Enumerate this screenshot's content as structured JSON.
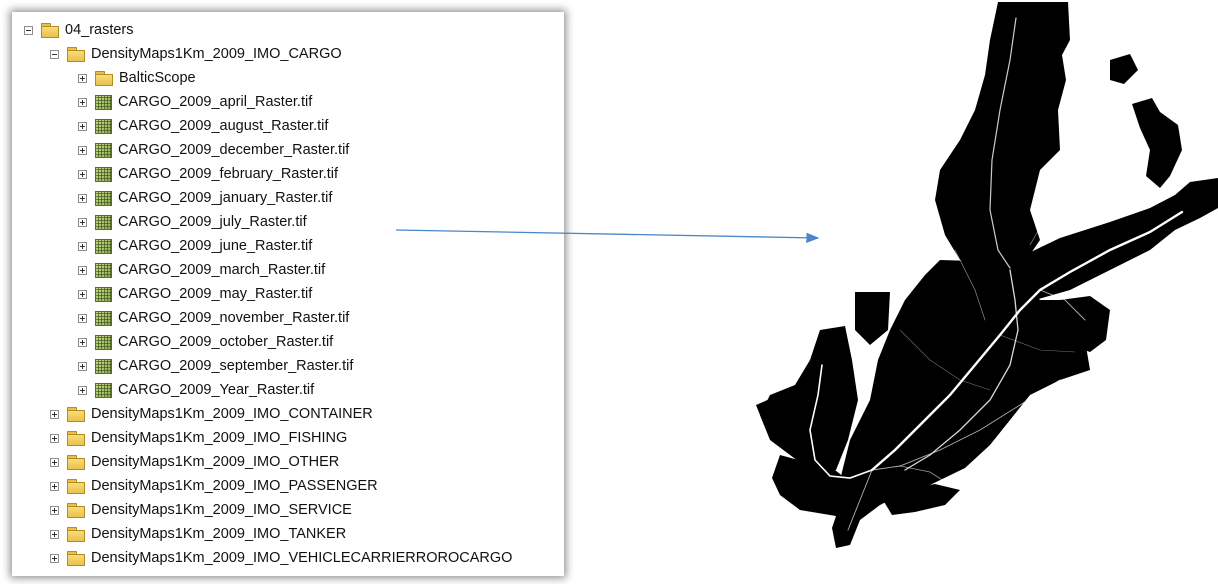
{
  "tree": {
    "root": {
      "label": "04_rasters",
      "icon": "folder-icon",
      "expanded": true
    },
    "cargo_group": {
      "label": "DensityMaps1Km_2009_IMO_CARGO",
      "icon": "folder-icon",
      "expanded": true
    },
    "cargo_children": [
      {
        "label": "BalticScope",
        "icon": "folder-icon"
      },
      {
        "label": "CARGO_2009_april_Raster.tif",
        "icon": "raster-icon"
      },
      {
        "label": "CARGO_2009_august_Raster.tif",
        "icon": "raster-icon"
      },
      {
        "label": "CARGO_2009_december_Raster.tif",
        "icon": "raster-icon"
      },
      {
        "label": "CARGO_2009_february_Raster.tif",
        "icon": "raster-icon"
      },
      {
        "label": "CARGO_2009_january_Raster.tif",
        "icon": "raster-icon"
      },
      {
        "label": "CARGO_2009_july_Raster.tif",
        "icon": "raster-icon"
      },
      {
        "label": "CARGO_2009_june_Raster.tif",
        "icon": "raster-icon"
      },
      {
        "label": "CARGO_2009_march_Raster.tif",
        "icon": "raster-icon"
      },
      {
        "label": "CARGO_2009_may_Raster.tif",
        "icon": "raster-icon"
      },
      {
        "label": "CARGO_2009_november_Raster.tif",
        "icon": "raster-icon"
      },
      {
        "label": "CARGO_2009_october_Raster.tif",
        "icon": "raster-icon"
      },
      {
        "label": "CARGO_2009_september_Raster.tif",
        "icon": "raster-icon"
      },
      {
        "label": "CARGO_2009_Year_Raster.tif",
        "icon": "raster-icon"
      }
    ],
    "other_groups": [
      {
        "label": "DensityMaps1Km_2009_IMO_CONTAINER",
        "icon": "folder-icon"
      },
      {
        "label": "DensityMaps1Km_2009_IMO_FISHING",
        "icon": "folder-icon"
      },
      {
        "label": "DensityMaps1Km_2009_IMO_OTHER",
        "icon": "folder-icon"
      },
      {
        "label": "DensityMaps1Km_2009_IMO_PASSENGER",
        "icon": "folder-icon"
      },
      {
        "label": "DensityMaps1Km_2009_IMO_SERVICE",
        "icon": "folder-icon"
      },
      {
        "label": "DensityMaps1Km_2009_IMO_TANKER",
        "icon": "folder-icon"
      },
      {
        "label": "DensityMaps1Km_2009_IMO_VEHICLECARRIERROROCARGO",
        "icon": "folder-icon"
      }
    ]
  },
  "colors": {
    "arrow": "#4a86c8",
    "map_background": "#000000",
    "shipping_lanes": "#ffffff"
  }
}
